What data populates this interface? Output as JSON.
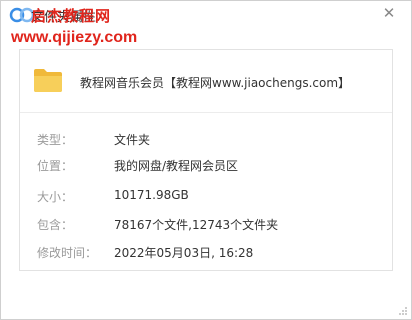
{
  "window": {
    "title": "文件夹属性",
    "close_icon": "close-icon"
  },
  "watermark": {
    "line1": "启杰教程网",
    "line2": "www.qijiezy.com",
    "color": "#e0251c"
  },
  "item": {
    "name": "教程网音乐会员【教程网www.jiaochengs.com】",
    "icon": "folder-icon",
    "icon_color": "#f5c84c"
  },
  "properties": [
    {
      "label": "类型：",
      "value": "文件夹"
    },
    {
      "label": "位置：",
      "value": "我的网盘/教程网会员区"
    },
    {
      "label": "大小：",
      "value": "10171.98GB"
    },
    {
      "label": "包含：",
      "value": "78167个文件,12743个文件夹"
    },
    {
      "label": "修改时间：",
      "value": "2022年05月03日, 16:28"
    }
  ]
}
